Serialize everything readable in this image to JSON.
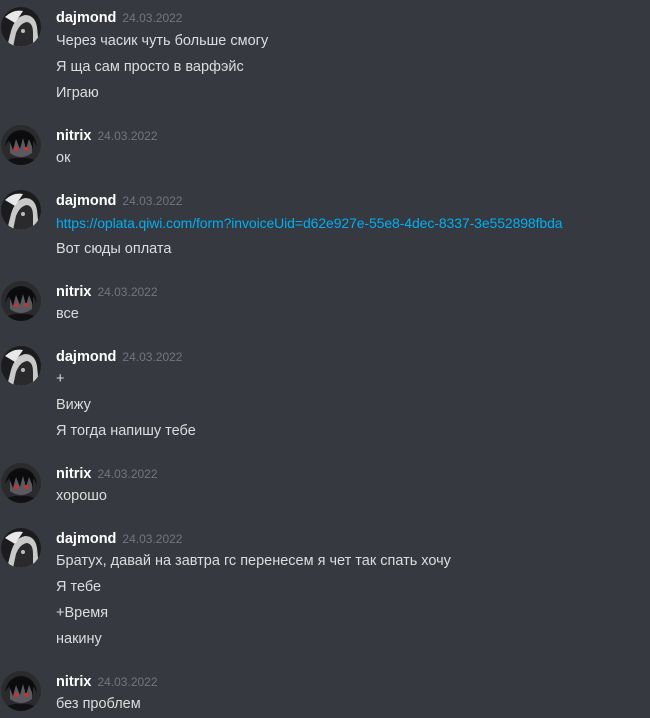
{
  "messages": [
    {
      "author": "dajmond",
      "avatar": "dajmond-avatar",
      "timestamp": "24.03.2022",
      "lines": [
        {
          "text": "Через часик чуть больше смогу"
        },
        {
          "text": "Я ща сам просто в варфэйс"
        },
        {
          "text": "Играю"
        }
      ]
    },
    {
      "author": "nitrix",
      "avatar": "nitrix-avatar",
      "timestamp": "24.03.2022",
      "lines": [
        {
          "text": "ок"
        }
      ]
    },
    {
      "author": "dajmond",
      "avatar": "dajmond-avatar",
      "timestamp": "24.03.2022",
      "lines": [
        {
          "text": "https://oplata.qiwi.com/form?invoiceUid=d62e927e-55e8-4dec-8337-3e552898fbda",
          "link": true
        },
        {
          "text": "Вот сюды оплата"
        }
      ]
    },
    {
      "author": "nitrix",
      "avatar": "nitrix-avatar",
      "timestamp": "24.03.2022",
      "lines": [
        {
          "text": "все"
        }
      ]
    },
    {
      "author": "dajmond",
      "avatar": "dajmond-avatar",
      "timestamp": "24.03.2022",
      "lines": [
        {
          "text": "+"
        },
        {
          "text": "Вижу"
        },
        {
          "text": "Я тогда напишу тебе"
        }
      ]
    },
    {
      "author": "nitrix",
      "avatar": "nitrix-avatar",
      "timestamp": "24.03.2022",
      "lines": [
        {
          "text": "хорошо"
        }
      ]
    },
    {
      "author": "dajmond",
      "avatar": "dajmond-avatar",
      "timestamp": "24.03.2022",
      "lines": [
        {
          "text": "Братух, давай на завтра гс перенесем я чет так спать хочу"
        },
        {
          "text": "Я тебе"
        },
        {
          "text": "+Время"
        },
        {
          "text": "накину"
        }
      ]
    },
    {
      "author": "nitrix",
      "avatar": "nitrix-avatar",
      "timestamp": "24.03.2022",
      "lines": [
        {
          "text": "без проблем"
        }
      ]
    }
  ],
  "colors": {
    "background": "#36393f",
    "username": "#ffffff",
    "timestamp": "#72767d",
    "text": "#dcddde",
    "link": "#00aff4"
  }
}
